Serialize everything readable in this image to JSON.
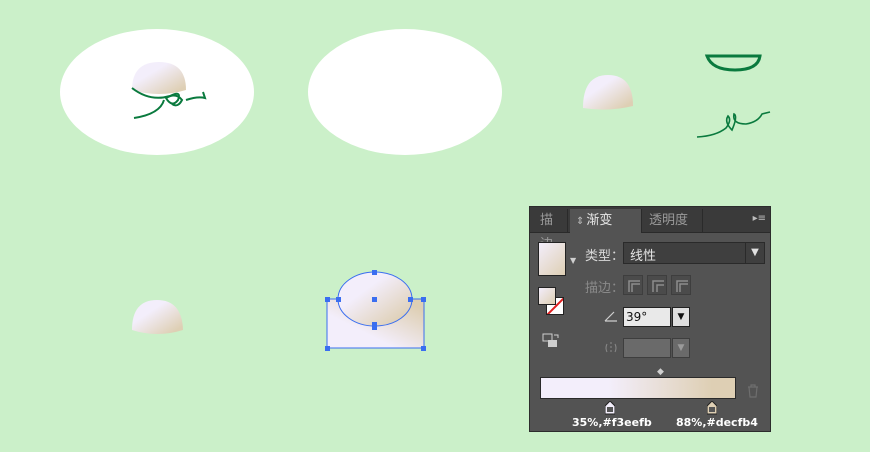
{
  "panel": {
    "tabs": [
      {
        "label": "描边",
        "active": false
      },
      {
        "label": "渐变",
        "active": true
      },
      {
        "label": "透明度",
        "active": false
      }
    ],
    "menu_icon": "panel-menu-icon",
    "type_label": "类型：",
    "type_value": "线性",
    "stroke_label": "描边：",
    "angle_value": "39°",
    "gradient_stops": [
      {
        "label": "35%,#f3eefb",
        "location": 0.35,
        "color": "#f3eefb"
      },
      {
        "label": "88%,#decfb4",
        "location": 0.88,
        "color": "#decfb4"
      }
    ]
  },
  "colors": {
    "background": "#cbf0c9",
    "stroke_green": "#0a7a3e",
    "selection_blue": "#3a6ef0",
    "gradient_start": "#f3eefb",
    "gradient_end": "#decfb4"
  }
}
